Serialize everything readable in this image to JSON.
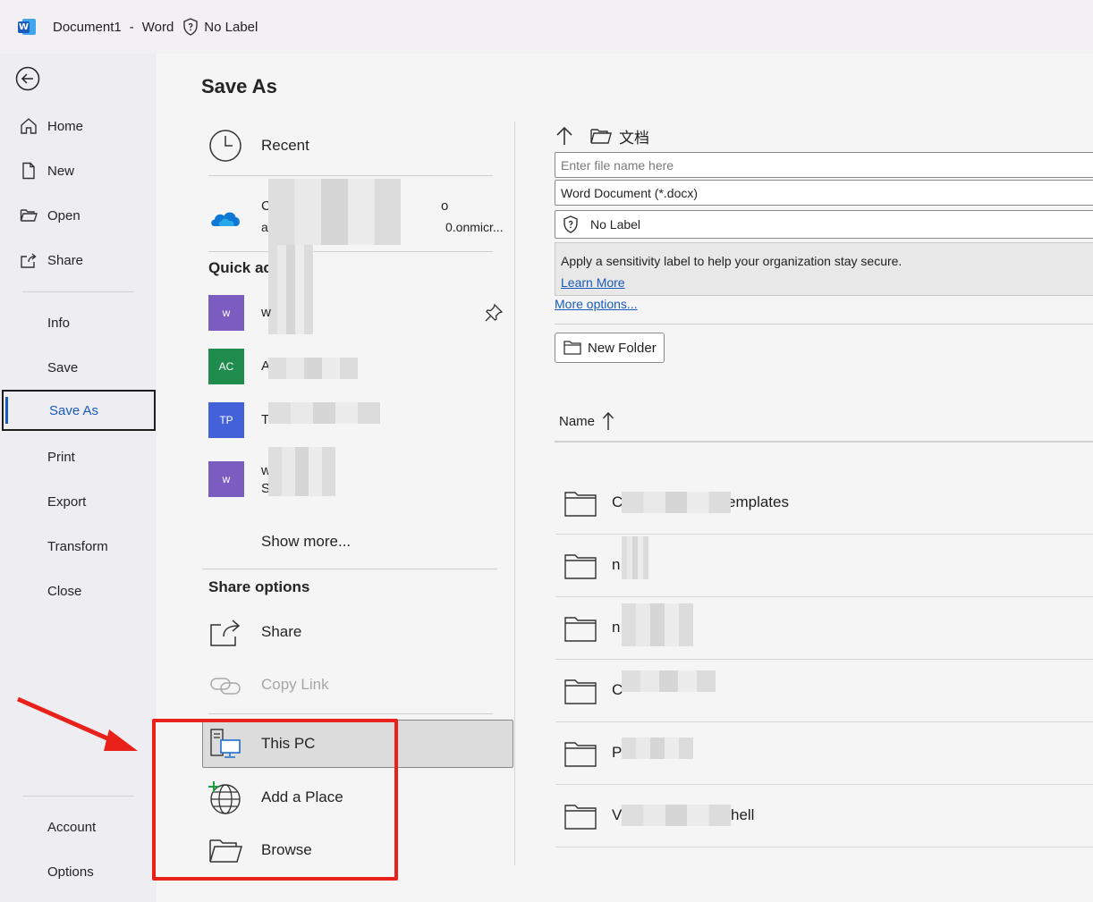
{
  "titlebar": {
    "doc_name": "Document1",
    "separator": "-",
    "app_name": "Word",
    "label_status": "No Label"
  },
  "nav": {
    "items": [
      {
        "label": "Home",
        "icon": "home-icon"
      },
      {
        "label": "New",
        "icon": "new-document-icon"
      },
      {
        "label": "Open",
        "icon": "open-folder-icon"
      },
      {
        "label": "Share",
        "icon": "share-icon"
      },
      {
        "label": "Info"
      },
      {
        "label": "Save"
      },
      {
        "label": "Save As",
        "selected": true
      },
      {
        "label": "Print"
      },
      {
        "label": "Export"
      },
      {
        "label": "Transform"
      },
      {
        "label": "Close"
      },
      {
        "label": "Account"
      },
      {
        "label": "Options"
      }
    ]
  },
  "main": {
    "title": "Save As",
    "locations": {
      "recent": "Recent",
      "onedrive_line1": "C",
      "onedrive_line1_end": "o",
      "onedrive_line2": "a",
      "onedrive_line2_end": "0.onmicr...",
      "quick_access_head": "Quick ac",
      "quick_access": [
        {
          "badge": "w",
          "color": "#7b5cc1",
          "text": "w"
        },
        {
          "badge": "AC",
          "color": "#1f8b4c",
          "text": "A"
        },
        {
          "badge": "TP",
          "color": "#4361d8",
          "text": "T"
        },
        {
          "badge": "w",
          "color": "#7b5cc1",
          "text": "w",
          "text2": "S"
        }
      ],
      "show_more": "Show more...",
      "share_options_head": "Share options",
      "share": "Share",
      "copy_link": "Copy Link",
      "this_pc": "This PC",
      "add_place": "Add a Place",
      "browse": "Browse"
    },
    "save_panel": {
      "folder": "文档",
      "filename_placeholder": "Enter file name here",
      "file_type": "Word Document (*.docx)",
      "sensitivity": "No Label",
      "info_text": "Apply a sensitivity label to help your organization stay secure.",
      "learn_more": "Learn More",
      "more_options": "More options...",
      "new_folder": "New Folder",
      "name_column": "Name",
      "files": [
        {
          "start": "C",
          "end": "emplates"
        },
        {
          "start": "n",
          "end": ""
        },
        {
          "start": "n",
          "end": ""
        },
        {
          "start": "C",
          "end": ""
        },
        {
          "start": "P",
          "end": ""
        },
        {
          "start": "V",
          "end": "hell"
        }
      ]
    }
  },
  "colors": {
    "accent": "#185abd",
    "annotation": "#e8221a"
  }
}
